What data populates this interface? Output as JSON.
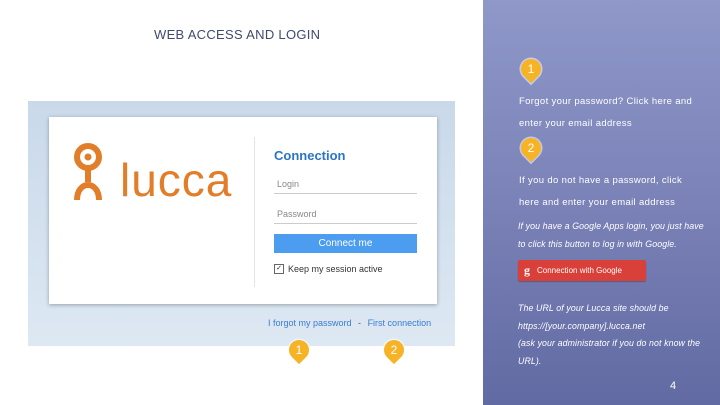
{
  "slide": {
    "title": "WEB ACCESS AND LOGIN",
    "page_number": "4"
  },
  "login_screenshot": {
    "logo_text": "lucca",
    "connection_title": "Connection",
    "login_placeholder": "Login",
    "password_placeholder": "Password",
    "connect_button": "Connect me",
    "keep_session_label": "Keep my session active",
    "keep_session_checked": true,
    "forgot_password_link": "I forgot my password",
    "separator": "-",
    "first_connection_link": "First connection",
    "markers": [
      "1",
      "2"
    ]
  },
  "instructions": [
    {
      "marker": "1",
      "lines": [
        "Forgot your password? Click here and",
        "enter your email address"
      ]
    },
    {
      "marker": "2",
      "lines": [
        "If you do not have a password, click",
        "here and enter your email address"
      ]
    }
  ],
  "google": {
    "note_lines": [
      "If you have a Google Apps login, you just have",
      "to click this button to log in with Google."
    ],
    "button_icon": "g",
    "button_label": "Connection with Google"
  },
  "url_note_lines": [
    "The URL of your Lucca site should be",
    "https://[your.company].lucca.net",
    "(ask your administrator if you do not know the",
    "URL)."
  ],
  "colors": {
    "panel": "#7a82b7",
    "marker": "#f6b325",
    "connection_blue": "#2c74c6",
    "connect_button": "#4c9df0",
    "google_red": "#d9403a",
    "lucca_orange": "#e27d2a"
  }
}
